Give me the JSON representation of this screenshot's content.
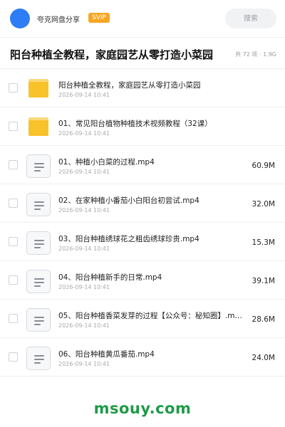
{
  "header": {
    "share_name": "夸克网盘分享",
    "badge": "SVIP",
    "search_placeholder": "搜索"
  },
  "title": {
    "text": "阳台种植全教程，家庭园艺从零打造小菜园",
    "summary": "共 72 项 · 1.9G"
  },
  "files": [
    {
      "type": "folder",
      "name": "阳台种植全教程，家庭园艺从零打造小菜园",
      "date": "2026-09-14 10:41",
      "size": ""
    },
    {
      "type": "folder",
      "name": "01、常见阳台植物种植技术视频教程（32课）",
      "date": "2026-09-14 10:41",
      "size": ""
    },
    {
      "type": "file",
      "name": "01、种植小白菜的过程.mp4",
      "date": "2026-09-14 10:41",
      "size": "60.9M"
    },
    {
      "type": "file",
      "name": "02、在家种植小番茄小白阳台初尝试.mp4",
      "date": "2026-09-14 10:41",
      "size": "32.0M"
    },
    {
      "type": "file",
      "name": "03、阳台种植绣球花之粗齿绣球珍贵.mp4",
      "date": "2026-09-14 10:41",
      "size": "15.3M"
    },
    {
      "type": "file",
      "name": "04、阳台种植新手的日常.mp4",
      "date": "2026-09-14 10:41",
      "size": "39.1M"
    },
    {
      "type": "file",
      "name": "05、阳台种植香菜发芽的过程【公众号：秘知圈】.m…",
      "date": "2026-09-14 10:41",
      "size": "28.6M"
    },
    {
      "type": "file",
      "name": "06、阳台种植黄瓜番茄.mp4",
      "date": "2026-09-14 10:41",
      "size": "24.0M"
    }
  ],
  "watermark": "msouy.com",
  "colors": {
    "accent": "#2d7df6",
    "svip_badge": "#f7a623",
    "folder": "#f8c32a",
    "watermark": "#1f9a48"
  },
  "icons": {
    "folder": "folder-icon",
    "file": "document-icon"
  }
}
